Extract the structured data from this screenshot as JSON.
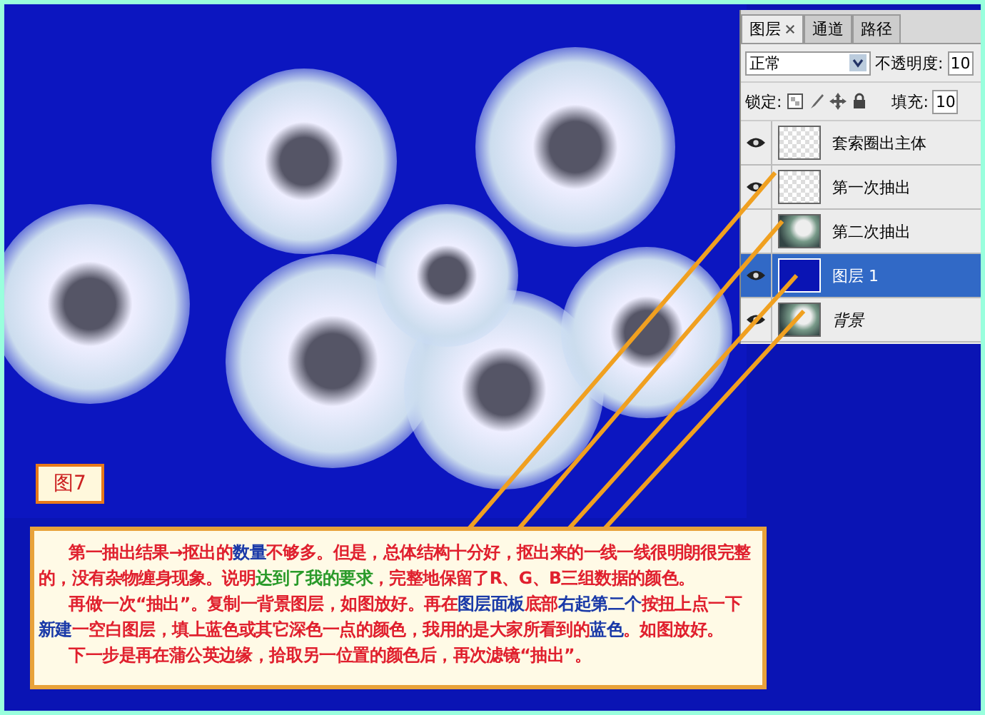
{
  "figure_label": "图7",
  "panel": {
    "tabs": [
      {
        "label": "图层",
        "selected": true,
        "closable": true
      },
      {
        "label": "通道",
        "selected": false,
        "closable": false
      },
      {
        "label": "路径",
        "selected": false,
        "closable": false
      }
    ],
    "blend_mode": "正常",
    "opacity_label": "不透明度:",
    "opacity_value": "10",
    "lock_label": "锁定:",
    "fill_label": "填充:",
    "fill_value": "10",
    "layers": [
      {
        "name": "套索圈出主体",
        "visible": true,
        "selected": false,
        "italic": false,
        "kind": "transparent"
      },
      {
        "name": "第一次抽出",
        "visible": true,
        "selected": false,
        "italic": false,
        "kind": "transparent"
      },
      {
        "name": "第二次抽出",
        "visible": false,
        "selected": false,
        "italic": false,
        "kind": "photo"
      },
      {
        "name": "图层 1",
        "visible": true,
        "selected": true,
        "italic": false,
        "kind": "fill"
      },
      {
        "name": "背景",
        "visible": true,
        "selected": false,
        "italic": true,
        "kind": "photo"
      }
    ]
  },
  "caption": [
    [
      {
        "text": "第一抽出结果→抠出的",
        "color": "#e0202e"
      },
      {
        "text": "数量",
        "color": "#1a3aa8"
      },
      {
        "text": "不够多。但是，总体结构十分好，抠出来的一线一线很明朗很完整的，没有杂物缠身现象。说明",
        "color": "#e0202e"
      },
      {
        "text": "达到了我的要求",
        "color": "#2a9a2a"
      },
      {
        "text": "，完整地保留了R、G、B三组数据的颜色。",
        "color": "#e0202e"
      }
    ],
    [
      {
        "text": "再做一次“抽出”。复制一背景图层，如图放好。再在",
        "color": "#e0202e"
      },
      {
        "text": "图层面板",
        "color": "#1a3aa8"
      },
      {
        "text": "底部",
        "color": "#e0202e"
      },
      {
        "text": "右起第二个",
        "color": "#1a3aa8"
      },
      {
        "text": "按扭上点一下",
        "color": "#e0202e"
      },
      {
        "text": "新建",
        "color": "#1a3aa8"
      },
      {
        "text": "一空白图层，填上蓝色或其它深色一点的颜色，我用的是大家所看到的",
        "color": "#e0202e"
      },
      {
        "text": "蓝色",
        "color": "#1a3aa8"
      },
      {
        "text": "。如图放好。",
        "color": "#e0202e"
      }
    ],
    [
      {
        "text": "下一步是再在蒲公英边缘，拾取另一位置的颜色后，再次滤镜“抽出”。",
        "color": "#e0202e"
      }
    ]
  ]
}
